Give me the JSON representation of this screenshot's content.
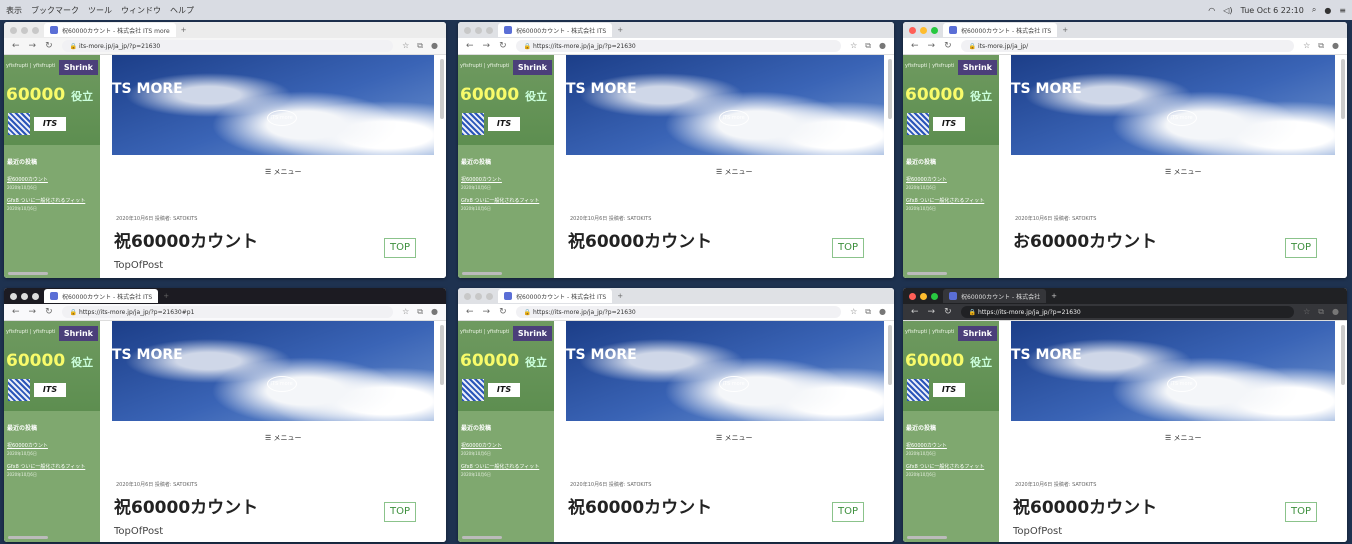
{
  "menubar": {
    "items": [
      "表示",
      "ブックマーク",
      "ツール",
      "ウィンドウ",
      "ヘルプ"
    ],
    "clock": "Tue Oct 6  22:10"
  },
  "site": {
    "shrink": "Shrink",
    "count_prefix": "60000",
    "count_suffix": "役立",
    "tagline": "TS MORE",
    "hdr": "yfisfrupti | yfisfrupti",
    "recent": "最近の投稿",
    "link1": "祝60000カウント",
    "link2": "Gfx8 ついに一般化されるフィット",
    "menu": "☰ メニュー",
    "meta": "2020年10月6日  投稿者: SATOKITS",
    "title": "祝60000カウント",
    "title_cut": "お60000カウント",
    "topofpost": "TopOfPost",
    "top": "TOP",
    "hero_badge": "ITS more"
  },
  "windows": [
    {
      "url": "its-more.jp/ja_jp/?p=21630",
      "tab": "祝60000カウント - 株式会社 ITS more",
      "variant": "safari"
    },
    {
      "url": "https://its-more.jp/ja_jp/?p=21630",
      "tab": "祝60000カウント - 株式会社 ITS",
      "variant": "chrome"
    },
    {
      "url": "its-more.jp/ja_jp/",
      "tab": "祝60000カウント - 株式会社 ITS",
      "variant": "chrome2"
    },
    {
      "url": "https://its-more.jp/ja_jp/?p=21630#p1",
      "tab": "祝60000カウント - 株式会社 ITS",
      "variant": "firefox"
    },
    {
      "url": "https://its-more.jp/ja_jp/?p=21630",
      "tab": "祝60000カウント - 株式会社 ITS",
      "variant": "chrome"
    },
    {
      "url": "https://its-more.jp/ja_jp/?p=21630",
      "tab": "祝60000カウント - 株式会社",
      "variant": "dark"
    }
  ]
}
